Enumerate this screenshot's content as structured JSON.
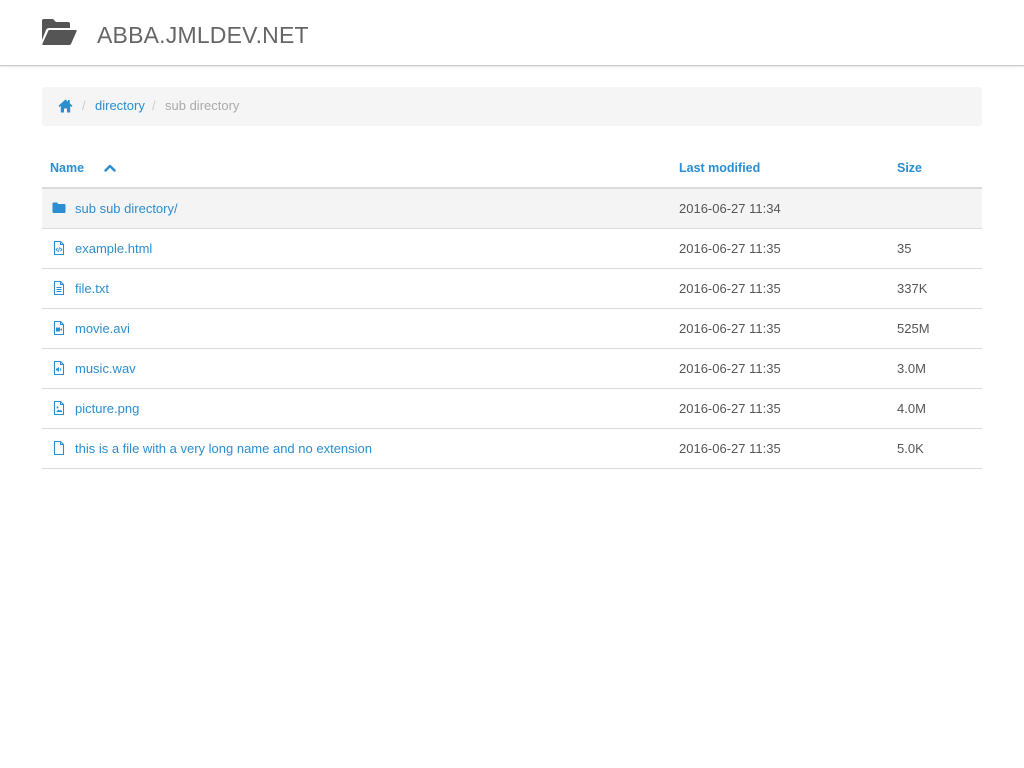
{
  "header": {
    "title": "ABBA.JMLDEV.NET",
    "logo_icon": "folder-open-icon"
  },
  "breadcrumb": {
    "home_icon": "home-icon",
    "items": [
      {
        "label": "directory",
        "link": true
      },
      {
        "label": "sub directory",
        "link": false
      }
    ],
    "separator": "/"
  },
  "table": {
    "headers": {
      "name": "Name",
      "modified": "Last modified",
      "size": "Size"
    },
    "sort_icon": "chevron-up-icon",
    "rows": [
      {
        "name": "sub sub directory/",
        "modified": "2016-06-27 11:34",
        "size": "",
        "icon": "folder-icon"
      },
      {
        "name": "example.html",
        "modified": "2016-06-27 11:35",
        "size": "35",
        "icon": "file-code-icon"
      },
      {
        "name": "file.txt",
        "modified": "2016-06-27 11:35",
        "size": "337K",
        "icon": "file-text-icon"
      },
      {
        "name": "movie.avi",
        "modified": "2016-06-27 11:35",
        "size": "525M",
        "icon": "file-video-icon"
      },
      {
        "name": "music.wav",
        "modified": "2016-06-27 11:35",
        "size": "3.0M",
        "icon": "file-audio-icon"
      },
      {
        "name": "picture.png",
        "modified": "2016-06-27 11:35",
        "size": "4.0M",
        "icon": "file-image-icon"
      },
      {
        "name": "this is a file with a very long name and no extension",
        "modified": "2016-06-27 11:35",
        "size": "5.0K",
        "icon": "file-icon"
      }
    ]
  },
  "colors": {
    "link": "#2b8ed0",
    "text": "#555555",
    "header_title": "#666666",
    "breadcrumb_bg": "#f5f5f5",
    "row_highlight": "#f4f4f4",
    "border": "#dcdcdc"
  }
}
